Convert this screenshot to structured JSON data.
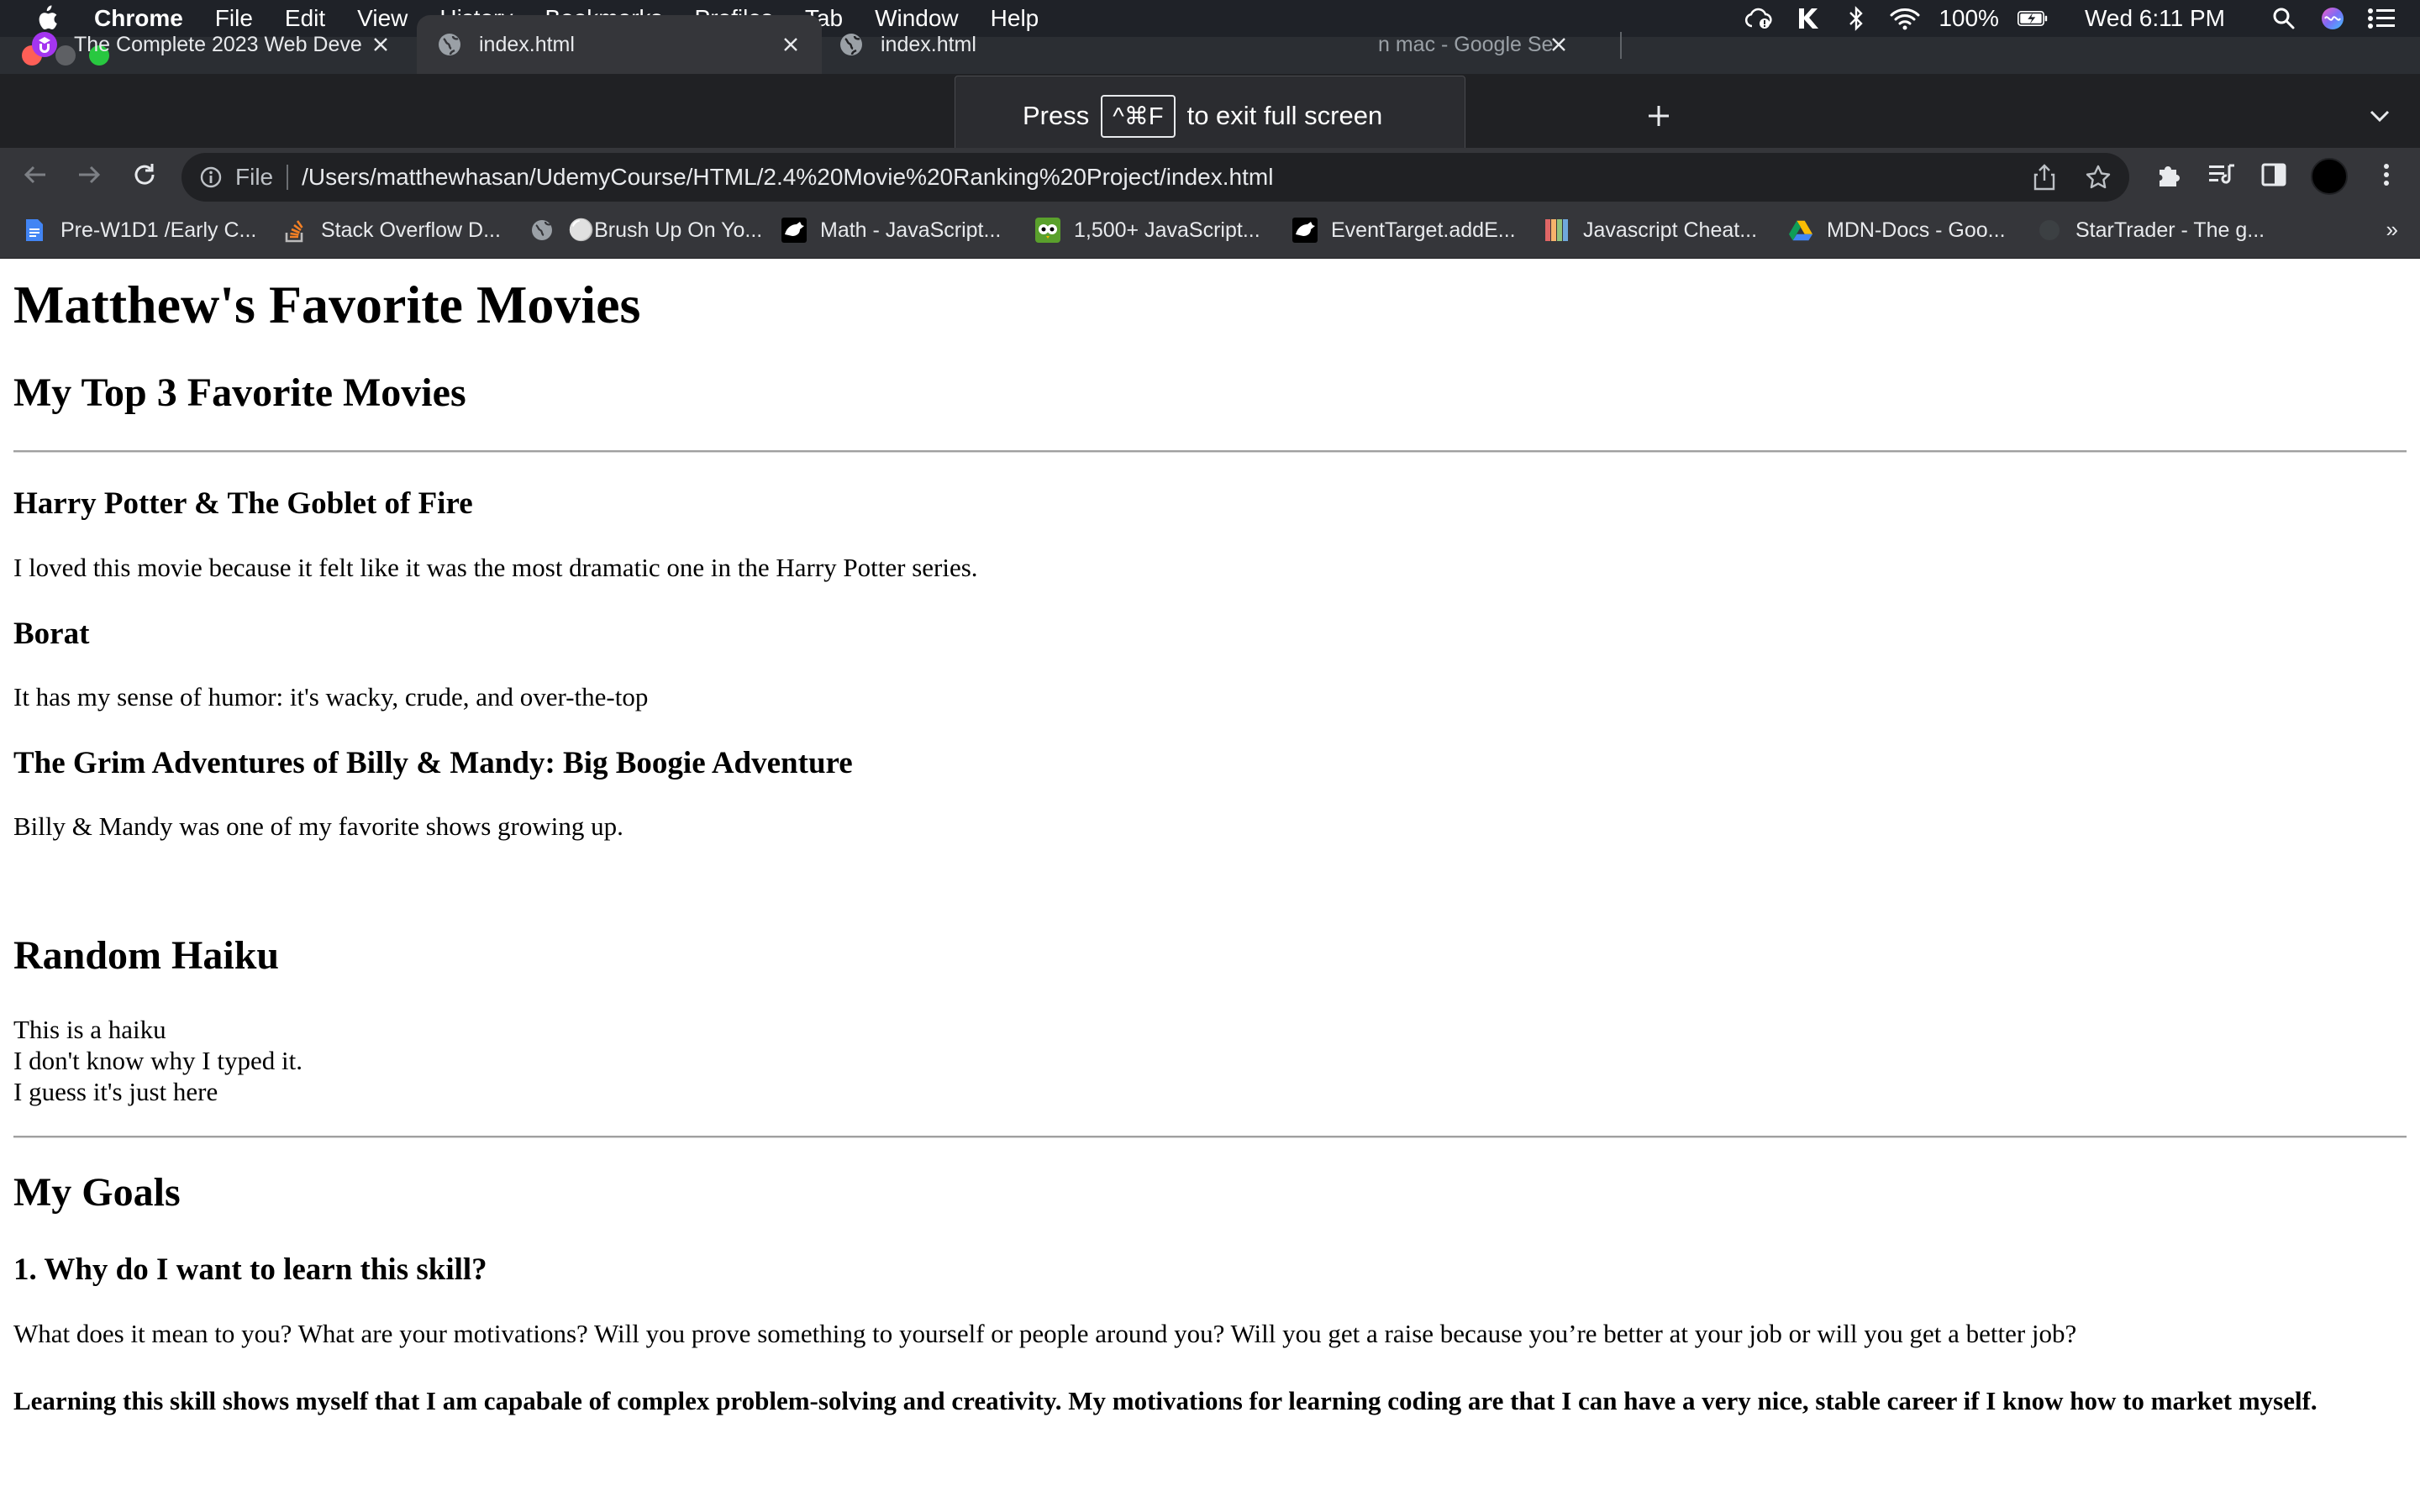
{
  "menubar": {
    "app": "Chrome",
    "items": [
      "File",
      "Edit",
      "View",
      "History",
      "Bookmarks",
      "Profiles",
      "Tab",
      "Window",
      "Help"
    ],
    "battery": "100%",
    "clock": "Wed 6:11 PM"
  },
  "tabs": [
    {
      "title": "The Complete 2023 Web Deve",
      "icon": "udemy-icon"
    },
    {
      "title": "index.html",
      "icon": "globe-icon"
    },
    {
      "title": "index.html",
      "icon": "globe-icon"
    },
    {
      "title": "n mac - Google Se",
      "icon": "google-icon"
    }
  ],
  "fullscreen_toast": {
    "press": "Press",
    "key": "^⌘F",
    "message": "to exit full screen"
  },
  "omnibox": {
    "scheme": "File",
    "url": "/Users/matthewhasan/UdemyCourse/HTML/2.4%20Movie%20Ranking%20Project/index.html"
  },
  "bookmarks": [
    {
      "label": "Pre-W1D1 /Early C...",
      "icon": "docs-icon",
      "color": "#4285f4"
    },
    {
      "label": "Stack Overflow D...",
      "icon": "stackoverflow-icon",
      "color": "#f48024"
    },
    {
      "label": "⚪Brush Up On Yo...",
      "icon": "globe-icon",
      "color": "#9aa0a6"
    },
    {
      "label": "Math - JavaScript...",
      "icon": "mdn-icon",
      "color": "#ffffff"
    },
    {
      "label": "1,500+ JavaScript...",
      "icon": "owl-icon",
      "color": "#5aa02c"
    },
    {
      "label": "EventTarget.addE...",
      "icon": "mdn-icon",
      "color": "#ffffff"
    },
    {
      "label": "Javascript Cheat...",
      "icon": "bars-icon",
      "color": "#e06666"
    },
    {
      "label": "MDN-Docs - Goo...",
      "icon": "drive-icon",
      "color": "#fbbc04"
    },
    {
      "label": "StarTrader - The g...",
      "icon": "dark-circle-icon",
      "color": "#3c4043"
    }
  ],
  "bookmarks_more": "»",
  "content": {
    "title": "Matthew's Favorite Movies",
    "top3_heading": "My Top 3 Favorite Movies",
    "movies": [
      {
        "name": "Harry Potter & The Goblet of Fire",
        "reason": "I loved this movie because it felt like it was the most dramatic one in the Harry Potter series."
      },
      {
        "name": "Borat",
        "reason": "It has my sense of humor: it's wacky, crude, and over-the-top"
      },
      {
        "name": "The Grim Adventures of Billy & Mandy: Big Boogie Adventure",
        "reason": "Billy & Mandy was one of my favorite shows growing up."
      }
    ],
    "haiku_heading": "Random Haiku",
    "haiku": [
      "This is a haiku",
      "I don't know why I typed it.",
      "I guess it's just here"
    ],
    "goals_heading": "My Goals",
    "goal1_question": "1. Why do I want to learn this skill?",
    "goal1_prompt": "What does it mean to you? What are your motivations? Will you prove something to yourself or people around you? Will you get a raise because you’re better at your job or will you get a better job?",
    "goal1_answer": "Learning this skill shows myself that I am capabale of complex problem-solving and creativity. My motivations for learning coding are that I can have a very nice, stable career if I know how to market myself."
  }
}
